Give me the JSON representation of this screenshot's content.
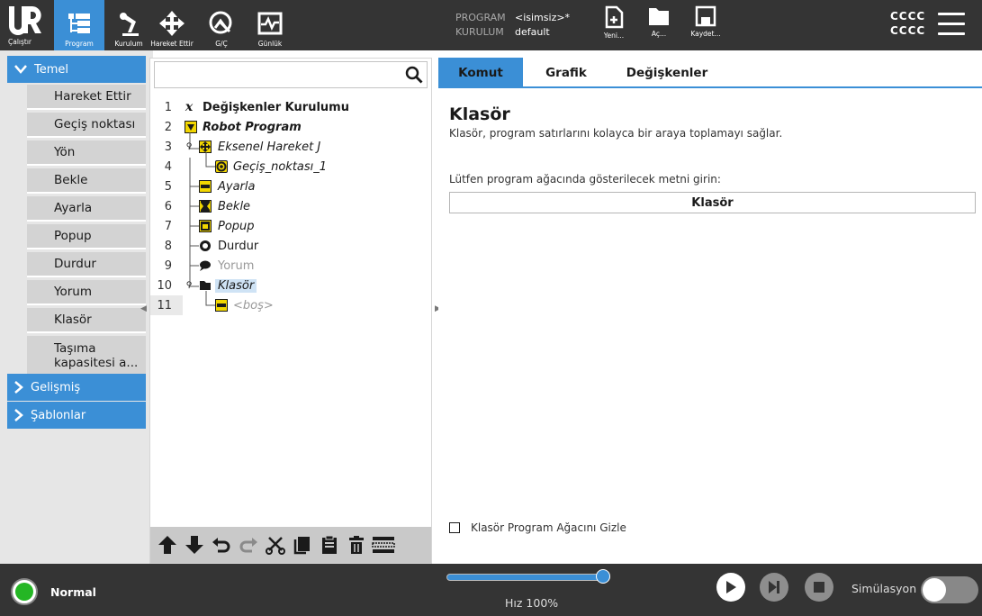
{
  "header": {
    "nav": [
      {
        "label": "Çalıştır",
        "icon": "ur-logo-icon"
      },
      {
        "label": "Program",
        "icon": "program-tree-icon",
        "active": true
      },
      {
        "label": "Kurulum",
        "icon": "robot-arm-icon"
      },
      {
        "label": "Hareket Ettir",
        "icon": "move-arrows-icon"
      },
      {
        "label": "G/Ç",
        "icon": "io-icon"
      },
      {
        "label": "Günlük",
        "icon": "log-icon"
      }
    ],
    "program_key": "PROGRAM",
    "program_value": "<isimsiz>*",
    "installation_key": "KURULUM",
    "installation_value": "default",
    "file_buttons": [
      {
        "label": "Yeni...",
        "icon": "new-file-icon"
      },
      {
        "label": "Aç...",
        "icon": "folder-icon"
      },
      {
        "label": "Kaydet...",
        "icon": "save-icon"
      }
    ],
    "user_line1": "CCCC",
    "user_line2": "CCCC",
    "accent": "#3b8fd6"
  },
  "sidebar": {
    "basic_label": "Temel",
    "items": [
      "Hareket Ettir",
      "Geçiş noktası",
      "Yön",
      "Bekle",
      "Ayarla",
      "Popup",
      "Durdur",
      "Yorum",
      "Klasör",
      "Taşıma kapasitesi a..."
    ],
    "advanced_label": "Gelişmiş",
    "templates_label": "Şablonlar"
  },
  "tree": {
    "search_placeholder": "",
    "rows": [
      {
        "num": "1",
        "text": "Değişkenler Kurulumu",
        "icon": "variable-x-icon"
      },
      {
        "num": "2",
        "text": "Robot Program",
        "icon": "robot-program-icon"
      },
      {
        "num": "3",
        "text": "Eksenel Hareket J",
        "icon": "move-joint-icon"
      },
      {
        "num": "4",
        "text": "Geçiş_noktası_1",
        "icon": "waypoint-icon"
      },
      {
        "num": "5",
        "text": "Ayarla",
        "icon": "set-icon"
      },
      {
        "num": "6",
        "text": "Bekle",
        "icon": "wait-hourglass-icon"
      },
      {
        "num": "7",
        "text": "Popup",
        "icon": "popup-icon"
      },
      {
        "num": "8",
        "text": "Durdur",
        "icon": "halt-hand-icon"
      },
      {
        "num": "9",
        "text": "Yorum",
        "icon": "comment-bubble-icon"
      },
      {
        "num": "10",
        "text": "Klasör",
        "icon": "folder-icon"
      },
      {
        "num": "11",
        "text": "<boş>",
        "icon": "empty-icon"
      }
    ],
    "toolbar": [
      "move-up-icon",
      "move-down-icon",
      "undo-icon",
      "redo-icon",
      "cut-icon",
      "copy-icon",
      "paste-icon",
      "delete-icon",
      "suppress-icon"
    ]
  },
  "right": {
    "tabs": [
      "Komut",
      "Grafik",
      "Değişkenler"
    ],
    "title": "Klasör",
    "description": "Klasör, program satırlarını kolayca bir araya toplamayı sağlar.",
    "prompt": "Lütfen program ağacında gösterilecek metni girin:",
    "input_value": "Klasör",
    "hide_checkbox_label": "Klasör Program Ağacını Gizle",
    "hide_checked": false
  },
  "footer": {
    "status": "Normal",
    "status_color": "#24b624",
    "speed_percent": 100,
    "speed_label": "Hız 100%",
    "simulation_label": "Simülasyon",
    "simulation_on": false
  }
}
